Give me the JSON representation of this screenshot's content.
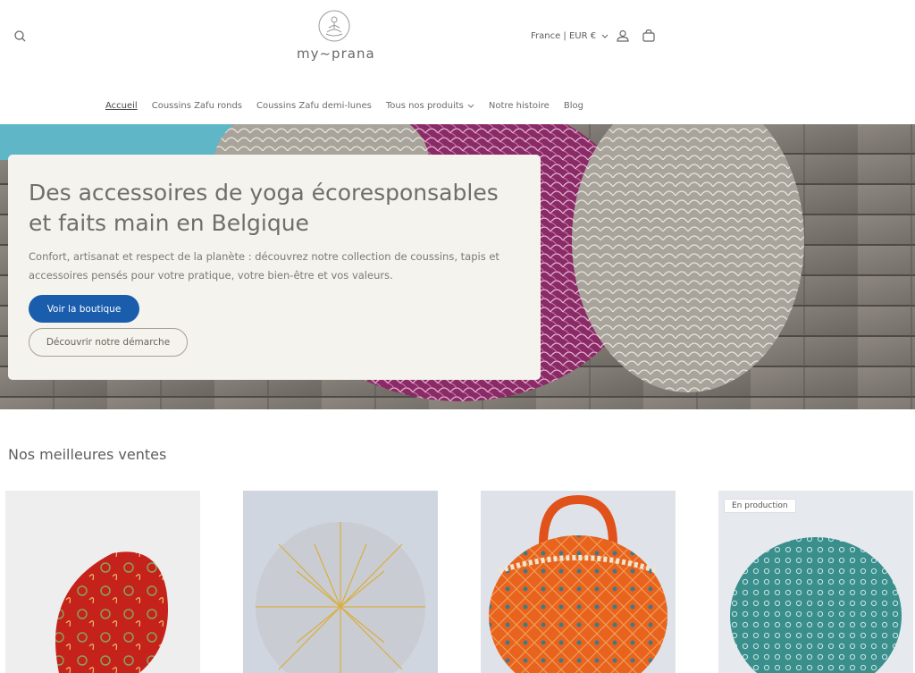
{
  "header": {
    "logo_text": "my~prana",
    "locale": "France | EUR €"
  },
  "nav": {
    "items": [
      {
        "label": "Accueil"
      },
      {
        "label": "Coussins Zafu ronds"
      },
      {
        "label": "Coussins Zafu demi-lunes"
      },
      {
        "label": "Tous nos produits"
      },
      {
        "label": "Notre histoire"
      },
      {
        "label": "Blog"
      }
    ]
  },
  "hero": {
    "title": "Des accessoires de yoga écoresponsables et faits main en Belgique",
    "text": "Confort, artisanat et respect de la planète : découvrez notre collection de coussins, tapis et accessoires pensés pour votre pratique, votre bien-être et vos valeurs.",
    "primary_button": "Voir la boutique",
    "secondary_button": "Découvrir notre démarche"
  },
  "bestsellers": {
    "title": "Nos meilleures ventes",
    "badge": "En production"
  },
  "colors": {
    "accent": "#1a5dad",
    "card_bg": "#f4f3ee"
  }
}
